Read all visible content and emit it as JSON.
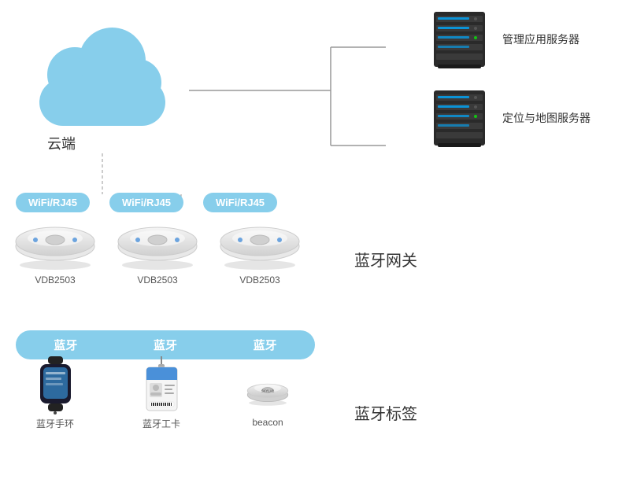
{
  "cloud": {
    "label": "云端"
  },
  "servers": [
    {
      "label": "管理应用服务器",
      "id": "server-management"
    },
    {
      "label": "定位与地图服务器",
      "id": "server-location"
    }
  ],
  "wifi_badges": [
    {
      "text": "WiFi/RJ45"
    },
    {
      "text": "WiFi/RJ45"
    },
    {
      "text": "WiFi/RJ45"
    }
  ],
  "gateways": [
    {
      "label": "VDB2503"
    },
    {
      "label": "VDB2503"
    },
    {
      "label": "VDB2503"
    }
  ],
  "gateway_section_label": "蓝牙网关",
  "bluetooth_badges": [
    {
      "text": "蓝牙"
    },
    {
      "text": "蓝牙"
    },
    {
      "text": "蓝牙"
    }
  ],
  "bt_devices": [
    {
      "label": "蓝牙手环",
      "type": "wristband"
    },
    {
      "label": "蓝牙工卡",
      "type": "idcard"
    },
    {
      "label": "beacon",
      "type": "beacon"
    }
  ],
  "bt_section_label": "蓝牙标签"
}
